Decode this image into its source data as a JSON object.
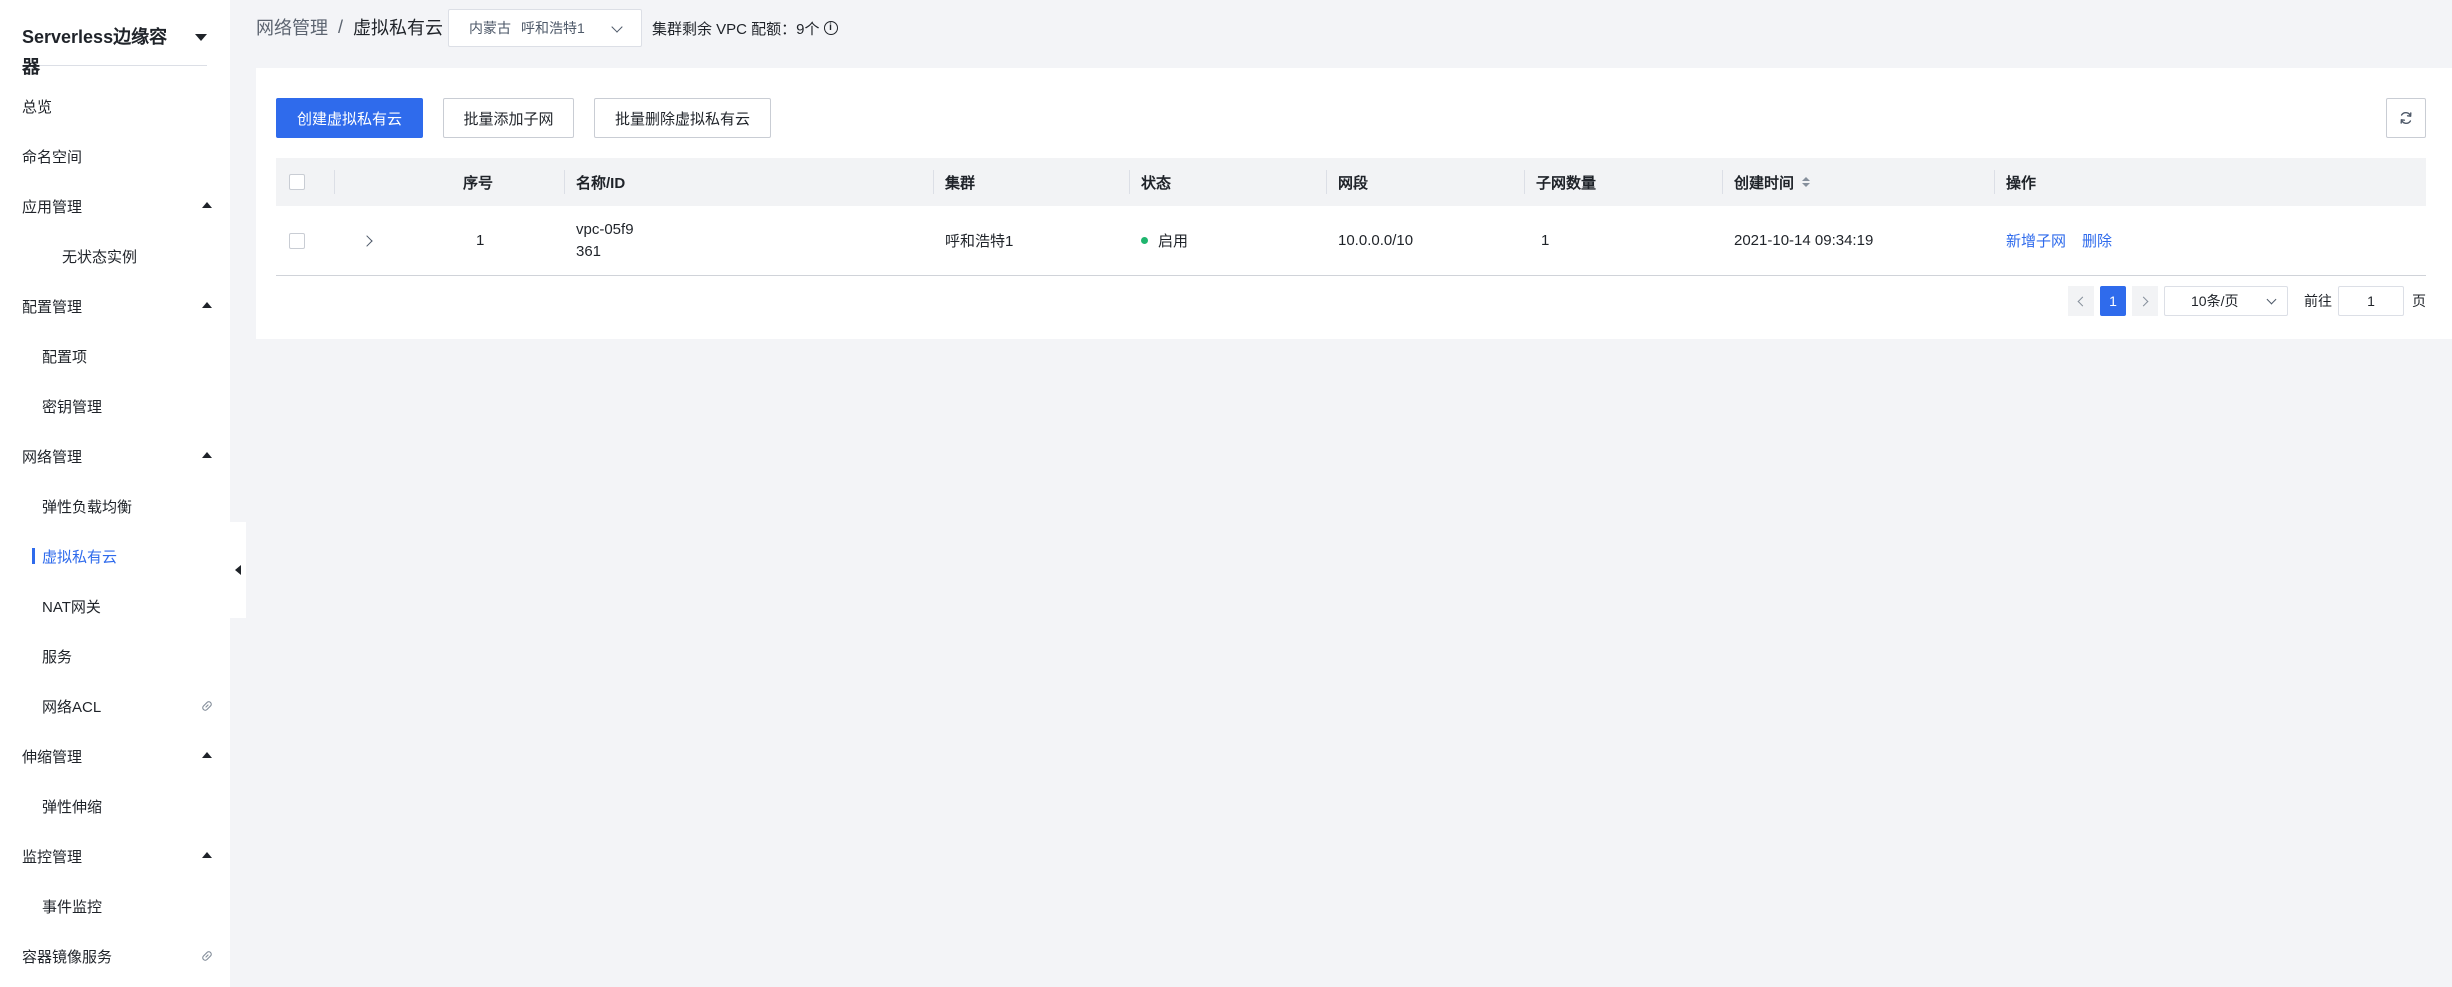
{
  "sidebar": {
    "product_title": "Serverless边缘容器",
    "items": [
      {
        "label": "总览"
      },
      {
        "label": "命名空间"
      },
      {
        "label": "应用管理"
      },
      {
        "label": "无状态实例"
      },
      {
        "label": "配置管理"
      },
      {
        "label": "配置项"
      },
      {
        "label": "密钥管理"
      },
      {
        "label": "网络管理"
      },
      {
        "label": "弹性负载均衡"
      },
      {
        "label": "虚拟私有云"
      },
      {
        "label": "NAT网关"
      },
      {
        "label": "服务"
      },
      {
        "label": "网络ACL"
      },
      {
        "label": "伸缩管理"
      },
      {
        "label": "弹性伸缩"
      },
      {
        "label": "监控管理"
      },
      {
        "label": "事件监控"
      },
      {
        "label": "容器镜像服务"
      }
    ]
  },
  "header": {
    "breadcrumb_parent": "网络管理",
    "breadcrumb_separator": "/",
    "breadcrumb_current": "虚拟私有云",
    "cluster_region": "内蒙古",
    "cluster_name": "呼和浩特1",
    "quota_text": "集群剩余 VPC 配额：9个"
  },
  "toolbar": {
    "create_label": "创建虚拟私有云",
    "batch_add_subnet_label": "批量添加子网",
    "batch_delete_label": "批量删除虚拟私有云"
  },
  "table": {
    "columns": {
      "index": "序号",
      "name_id": "名称/ID",
      "cluster": "集群",
      "status": "状态",
      "cidr": "网段",
      "subnet_count": "子网数量",
      "created_at": "创建时间",
      "actions": "操作"
    },
    "rows": [
      {
        "index": "1",
        "name_line1": "vpc-05f9",
        "name_line2": "361",
        "cluster": "呼和浩特1",
        "status": "启用",
        "cidr": "10.0.0.0/10",
        "subnet_count": "1",
        "created_at": "2021-10-14 09:34:19",
        "action_add_subnet": "新增子网",
        "action_delete": "删除"
      }
    ]
  },
  "pagination": {
    "current_page": "1",
    "page_size": "10条/页",
    "goto_label": "前往",
    "goto_value": "1",
    "page_suffix": "页"
  },
  "colors": {
    "primary": "#2f6bec",
    "status_enabled": "#1fb56e",
    "background": "#f3f4f7"
  }
}
